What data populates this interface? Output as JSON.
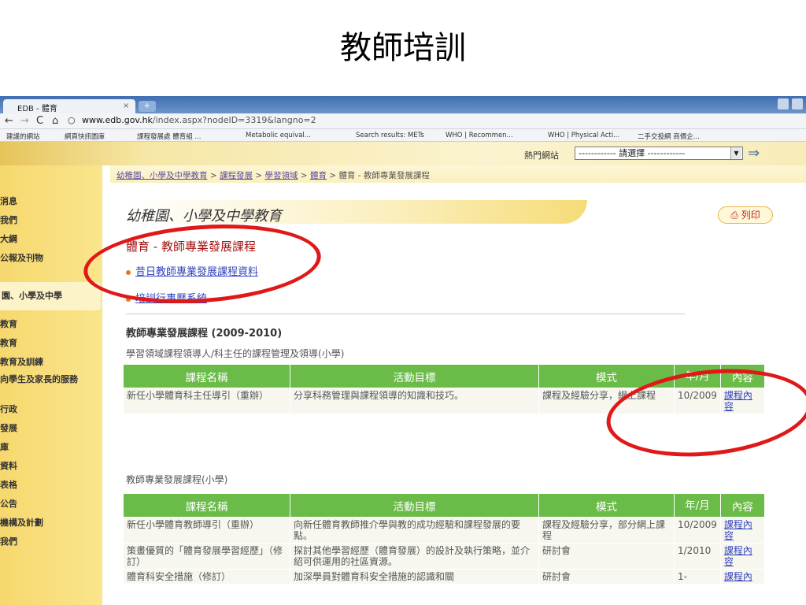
{
  "slide": {
    "title": "教師培訓"
  },
  "browser": {
    "tab_title": "EDB - 體育",
    "tab_close": "×",
    "url_domain": "www.edb.gov.hk",
    "url_path": "/index.aspx?nodeID=3319&langno=2",
    "bookmarks": [
      "建議的網站",
      "網頁快訊圖庫",
      "課程發展處 體育組 ...",
      "Metabolic equival...",
      "Search results: METs",
      "WHO | Recommen...",
      "WHO | Physical Acti...",
      "二手交投網 商價企..."
    ]
  },
  "header": {
    "hot_label": "熱門網站",
    "hot_select": "------------ 請選擇 ------------"
  },
  "breadcrumb": {
    "links": [
      "幼稚園、小學及中學教育",
      "課程發展",
      "學習領域",
      "體育"
    ],
    "sep": " > ",
    "current": "體育 - 教師專業發展課程"
  },
  "leftnav": {
    "items": [
      "消息",
      "我們",
      "大綱",
      "公報及刊物",
      "園、小學及中學",
      "教育",
      "教育",
      "教育及訓練",
      "向學生及家長的服務",
      "行政",
      "發展",
      "庫",
      "資料",
      "表格",
      "公告",
      "機構及計劃",
      "我們"
    ],
    "active_index": 4
  },
  "main": {
    "section_title": "幼稚園、小學及中學教育",
    "print_label": "列印",
    "course_heading": "體育 - 教師專業發展課程",
    "links": [
      "昔日教師專業發展課程資料",
      "培訓行事曆系統"
    ],
    "sub_heading": "教師專業發展課程 (2009-2010)",
    "table1_caption": "學習領域課程領導人/科主任的課程管理及領導(小學)",
    "table2_caption": "教師專業發展課程(小學)"
  },
  "table1": {
    "headers": [
      "課程名稱",
      "活動目標",
      "模式",
      "年/月",
      "內容"
    ],
    "rows": [
      [
        "新任小學體育科主任導引（重辦）",
        "分享科務管理與課程領導的知識和技巧。",
        "課程及經驗分享，網上課程",
        "10/2009",
        "課程內容"
      ]
    ]
  },
  "table2": {
    "headers": [
      "課程名稱",
      "活動目標",
      "模式",
      "年/月",
      "內容"
    ],
    "rows": [
      [
        "新任小學體育教師導引（重辦）",
        "向新任體育教師推介學與教的成功經驗和課程發展的要點。",
        "課程及經驗分享，部分網上課程",
        "10/2009",
        "課程內容"
      ],
      [
        "策畫優質的「體育發展學習經歷」（修訂）",
        "探討其他學習經歷（體育發展）的設計及執行策略，並介紹可供運用的社區資源。",
        "研討會",
        "1/2010",
        "課程內容"
      ],
      [
        "體育科安全措施（修訂）",
        "加深學員對體育科安全措施的認識和關",
        "研討會",
        "1-",
        "課程內"
      ]
    ]
  }
}
